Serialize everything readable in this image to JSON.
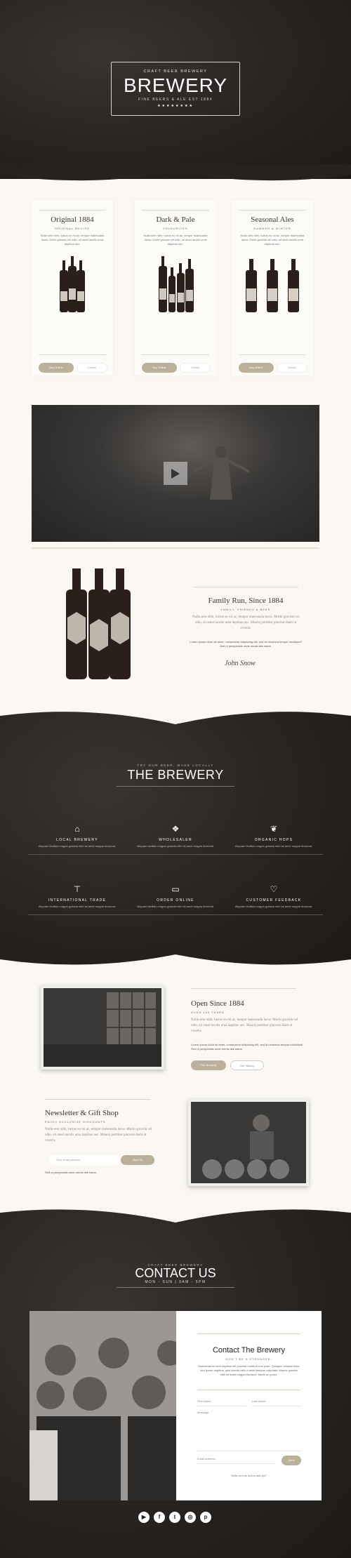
{
  "hero": {
    "pre": "CRAFT BEER BREWERY",
    "title": "BREWERY",
    "sub": "FINE BEERS & ALE EST 1884",
    "stars": "★★★★★★★★"
  },
  "cards": [
    {
      "title": "Original 1884",
      "sub": "ORIGINAL RECIPE",
      "text": "Nulla sem nibh, luctus eu mi ac, tempor malesuada lacus. Morbi gravida vel odio, sit amet iaculis urna dapibus nec.",
      "btn1": "Buy Online",
      "btn2": "Details"
    },
    {
      "title": "Dark & Pale",
      "sub": "FAVOURITES",
      "text": "Nulla sem nibh, luctus eu mi ac, tempor malesuada lacus. Morbi gravida vel odio, sit amet iaculis urna dapibus nec.",
      "btn1": "Buy Online",
      "btn2": "Details"
    },
    {
      "title": "Seasonal Ales",
      "sub": "SUMMER & WINTER",
      "text": "Nulla sem nibh, luctus eu mi ac, tempor malesuada lacus. Morbi gravida vel odio, sit amet iaculis urna dapibus nec.",
      "btn1": "Buy Online",
      "btn2": "Details"
    }
  ],
  "family": {
    "title": "Family Run, Since 1884",
    "sub": "FAMILY, FRIENDS & BEER",
    "p1": "Nulla sem nibh, luctus eu mi ac, tempor malesuada lacus. Morbi gravida vel odio, sit amet iaculis urna dapibus nec. Mauris porttitor placerat diam ut viverra.",
    "p2": "Lorem ipsum dolor sit amet, consectetur adipiscing elit, sed do eiusmod tempor incididunt! Sed ut perspiciatis unde omnis iste natus.",
    "sig": "John Snow"
  },
  "brewery": {
    "pre": "TRY OUR BEER, MADE LOCALLY",
    "title": "THE BREWERY",
    "features": [
      {
        "icon": "home-icon",
        "glyph": "⌂",
        "title": "LOCAL BREWERY",
        "text": "Aliquam facilisis magna gravida nibh sit amet magna tincidunt."
      },
      {
        "icon": "dropbox-icon",
        "glyph": "❖",
        "title": "WHOLESALER",
        "text": "Aliquam facilisis magna gravida nibh sit amet magna tincidunt."
      },
      {
        "icon": "leaf-icon",
        "glyph": "❦",
        "title": "ORGANIC HOPS",
        "text": "Aliquam facilisis magna gravida nibh sit amet magna tincidunt."
      },
      {
        "icon": "signpost-icon",
        "glyph": "⊤",
        "title": "INTERNATIONAL TRADE",
        "text": "Aliquam facilisis magna gravida nibh sit amet magna tincidunt."
      },
      {
        "icon": "monitor-icon",
        "glyph": "▭",
        "title": "ORDER ONLINE",
        "text": "Aliquam facilisis magna gravida nibh sit amet magna tincidunt."
      },
      {
        "icon": "heart-icon",
        "glyph": "♡",
        "title": "CUSTOMER FEEDBACK",
        "text": "Aliquam facilisis magna gravida nibh sit amet magna tincidunt."
      }
    ]
  },
  "open": {
    "title": "Open Since 1884",
    "sub": "OVER 100 YEARS",
    "p1": "Nulla sem nibh, luctus eu mi ac, tempor malesuada lacus. Morbi gravida vel odio, sit amet iaculis urna dapibus nec. Mauris porttitor placerat diam ut viverra.",
    "p2": "Lorem ipsum dolor sit amet, consectetur adipiscing elit, sed do eiusmod tempor incididunt! Sed ut perspiciatis unde omnis iste natus.",
    "btn1": "The Brewery",
    "btn2": "Our History"
  },
  "newsletter": {
    "title": "Newsletter & Gift Shop",
    "sub": "ENJOY EXCLUSIVE DISCOUNTS",
    "p1": "Nulla sem nibh, luctus eu mi ac, tempor malesuada lacus. Morbi gravida vel odio, sit amet iaculis urna dapibus nec. Mauris porttitor placerat diam ut viverra.",
    "placeholder": "Your email address",
    "btn": "Sign Up",
    "note": "Sed ut perspiciatis unde omnis iste natus."
  },
  "contact": {
    "pre": "CRAFT BEER BREWERY",
    "title": "CONTACT US",
    "hours": "MON - SUN | 9AM - 5PM",
    "form_title": "Contact The Brewery",
    "form_sub": "DON'T BE A STRANGER!",
    "form_text": "Maecenas eu sem dapibus elit pulvinar mollis et non justo. Quisque volutpat dolor sed ipsum dapibus, quis blandit velit ut amet tempus vulputate. Mauris gravida nibh sit amet magna tincidunt. Morbi ac purus.",
    "first": "First Name",
    "last": "Last Name",
    "message": "Message",
    "email": "Email Address",
    "send": "Send",
    "note": "Nulla sem ac luctus sed qui?",
    "socials": [
      "YouTube",
      "Facebook",
      "Twitter",
      "Instagram",
      "Pinterest"
    ]
  }
}
